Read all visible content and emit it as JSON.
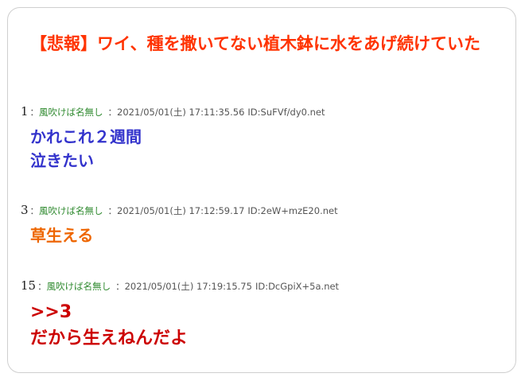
{
  "thread": {
    "title": "【悲報】ワイ、種を撒いてない植木鉢に水をあげ続けていた"
  },
  "posts": [
    {
      "number": "1",
      "separator": "：",
      "name": "風吹けば名無し",
      "date": "：2021/05/01(土) 17:11:35.56",
      "id": "ID:SuFVf/dy0.net",
      "lines": [
        "かれこれ２週間",
        "泣きたい"
      ],
      "color": "#3333cc"
    },
    {
      "number": "3",
      "separator": "：",
      "name": "風吹けば名無し",
      "date": "：2021/05/01(土) 17:12:59.17",
      "id": "ID:2eW+mzE20.net",
      "lines": [
        "草生える"
      ],
      "color": "#ee6600"
    },
    {
      "number": "15",
      "separator": "：",
      "name": "風吹けば名無し",
      "date": "：2021/05/01(土) 17:19:15.75",
      "id": "ID:DcGpiX+5a.net",
      "lines": [
        ">>3",
        "だから生えねんだよ"
      ],
      "color": "#cc0000"
    }
  ]
}
